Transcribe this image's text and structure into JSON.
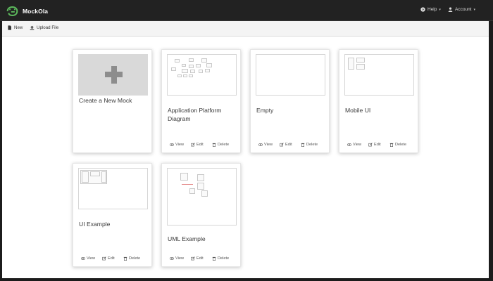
{
  "app": {
    "name": "MockOla"
  },
  "nav": {
    "help_label": "Help",
    "account_label": "Account"
  },
  "toolbar": {
    "new_label": "New",
    "upload_label": "Upload File"
  },
  "new_card": {
    "label": "Create a New Mock"
  },
  "actions": {
    "view": "View",
    "edit": "Edit",
    "delete": "Delete"
  },
  "mocks": [
    {
      "title": "Application Platform Diagram"
    },
    {
      "title": "Empty"
    },
    {
      "title": "Mobile UI"
    },
    {
      "title": "UI Example"
    },
    {
      "title": "UML Example"
    }
  ],
  "icons": {
    "logo": "frog-logo-icon",
    "help": "question-circle-icon",
    "account": "user-icon",
    "new": "file-icon",
    "upload": "upload-icon",
    "view": "eye-icon",
    "edit": "edit-icon",
    "delete": "trash-icon",
    "create": "plus-icon",
    "dropdown": "caret-down-icon"
  },
  "colors": {
    "navbar": "#222222",
    "background": "#1c1c1c",
    "page": "#ffffff",
    "brand_green": "#5cb85c"
  }
}
